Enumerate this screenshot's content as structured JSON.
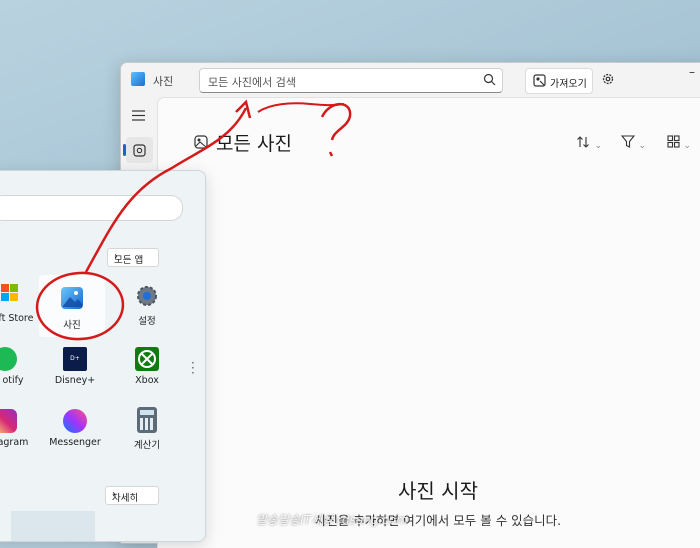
{
  "window": {
    "app_title": "사진",
    "search_placeholder": "모든 사진에서 검색",
    "import_label": "가져오기",
    "page_title": "모든 사진",
    "empty_title": "사진 시작",
    "empty_description": "사진을 추가하면 여기에서 모두 볼 수 있습니다."
  },
  "start_menu": {
    "all_apps_label": "모든 앱",
    "more_label": "자세히",
    "apps": [
      {
        "label": "oft Store",
        "icon": "microsoft-store-icon"
      },
      {
        "label": "사진",
        "icon": "photos-icon"
      },
      {
        "label": "설정",
        "icon": "settings-icon"
      },
      {
        "label": "otify",
        "icon": "spotify-icon"
      },
      {
        "label": "Disney+",
        "icon": "disney-plus-icon"
      },
      {
        "label": "Xbox",
        "icon": "xbox-icon"
      },
      {
        "label": "agram",
        "icon": "instagram-icon"
      },
      {
        "label": "Messenger",
        "icon": "messenger-icon"
      },
      {
        "label": "계산기",
        "icon": "calculator-icon"
      }
    ]
  },
  "watermark": "알송달송IT세상 rdsong.com",
  "colors": {
    "accent": "#2063c4",
    "annotation": "#d41a1a"
  }
}
